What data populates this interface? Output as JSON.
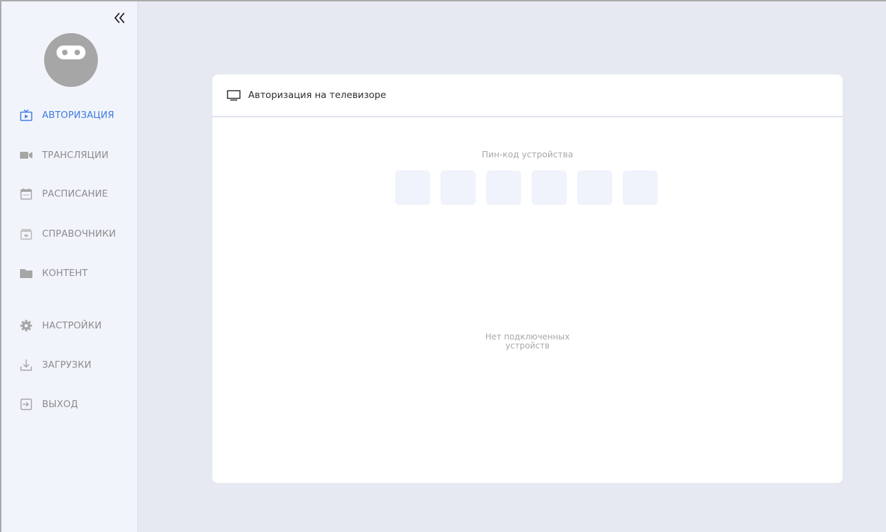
{
  "sidebar": {
    "collapse_label": "«",
    "items": [
      {
        "label": "АВТОРИЗАЦИЯ",
        "icon": "tv-play-icon",
        "active": true
      },
      {
        "label": "ТРАНСЛЯЦИИ",
        "icon": "video-camera-icon",
        "active": false
      },
      {
        "label": "РАСПИСАНИЕ",
        "icon": "calendar-icon",
        "active": false
      },
      {
        "label": "СПРАВОЧНИКИ",
        "icon": "archive-icon",
        "active": false
      },
      {
        "label": "КОНТЕНТ",
        "icon": "folder-icon",
        "active": false
      },
      {
        "label": "НАСТРОЙКИ",
        "icon": "gear-icon",
        "active": false
      },
      {
        "label": "ЗАГРУЗКИ",
        "icon": "download-icon",
        "active": false
      },
      {
        "label": "ВЫХОД",
        "icon": "logout-icon",
        "active": false
      }
    ]
  },
  "card": {
    "title": "Авторизация на телевизоре",
    "pin_label": "Пин-код устройства",
    "pin_values": [
      "",
      "",
      "",
      "",
      "",
      ""
    ],
    "empty_message": "Нет подключенных\nустройств"
  },
  "colors": {
    "accent": "#3d7be0",
    "sidebar_bg": "#f1f4fb",
    "main_bg": "#e6e9f2",
    "muted_text": "#8c8c8c"
  }
}
